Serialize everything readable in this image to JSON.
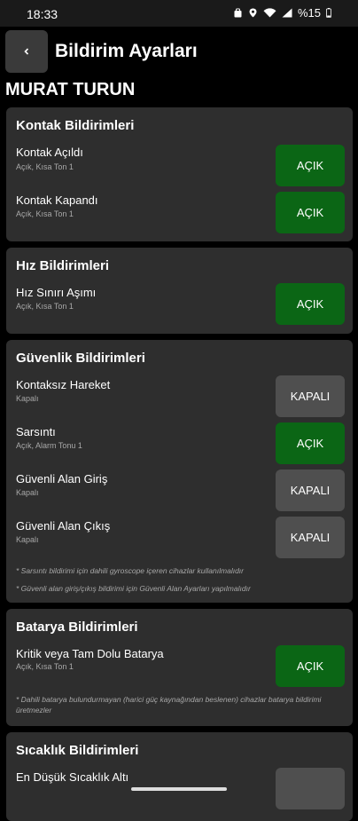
{
  "status": {
    "time": "18:33",
    "battery": "%15"
  },
  "header": {
    "title": "Bildirim Ayarları"
  },
  "user": {
    "name": "MURAT TURUN"
  },
  "sections": {
    "kontak": {
      "title": "Kontak Bildirimleri",
      "items": [
        {
          "title": "Kontak Açıldı",
          "subtitle": "Açık, Kısa Ton 1",
          "state": "AÇIK"
        },
        {
          "title": "Kontak Kapandı",
          "subtitle": "Açık, Kısa Ton 1",
          "state": "AÇIK"
        }
      ]
    },
    "hiz": {
      "title": "Hız Bildirimleri",
      "items": [
        {
          "title": "Hız Sınırı Aşımı",
          "subtitle": "Açık, Kısa Ton 1",
          "state": "AÇIK"
        }
      ]
    },
    "guvenlik": {
      "title": "Güvenlik Bildirimleri",
      "items": [
        {
          "title": "Kontaksız Hareket",
          "subtitle": "Kapalı",
          "state": "KAPALI"
        },
        {
          "title": "Sarsıntı",
          "subtitle": "Açık, Alarm Tonu 1",
          "state": "AÇIK"
        },
        {
          "title": "Güvenli Alan Giriş",
          "subtitle": "Kapalı",
          "state": "KAPALI"
        },
        {
          "title": "Güvenli Alan Çıkış",
          "subtitle": "Kapalı",
          "state": "KAPALI"
        }
      ],
      "notes": [
        "* Sarsıntı bildirimi için dahili gyroscope içeren cihazlar kullanılmalıdır",
        "* Güvenli alan giriş/çıkış bildirimi için Güvenli Alan Ayarları yapılmalıdır"
      ]
    },
    "batarya": {
      "title": "Batarya Bildirimleri",
      "items": [
        {
          "title": "Kritik veya Tam Dolu Batarya",
          "subtitle": "Açık, Kısa Ton 1",
          "state": "AÇIK"
        }
      ],
      "notes": [
        "* Dahili batarya bulundurmayan (harici güç kaynağından beslenen) cihazlar batarya bildirimi üretmezler"
      ]
    },
    "sicaklik": {
      "title": "Sıcaklık Bildirimleri",
      "items": [
        {
          "title": "En Düşük Sıcaklık Altı"
        }
      ]
    }
  },
  "colors": {
    "on": "#0b6615",
    "off": "#4f4f4f",
    "card": "#2e2e2e"
  },
  "icons": {
    "back": "arrow-left-icon"
  }
}
